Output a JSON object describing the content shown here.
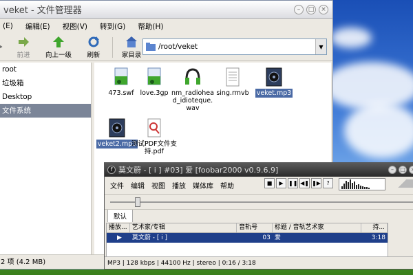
{
  "file_manager": {
    "title": "veket - 文件管理器",
    "menu": [
      "(E)",
      "编辑(E)",
      "视图(V)",
      "转到(G)",
      "帮助(H)"
    ],
    "toolbar": {
      "forward": "前进",
      "up": "向上一级",
      "refresh": "刷新",
      "home": "家目录"
    },
    "address": "/root/veket",
    "sidebar": [
      "root",
      "垃圾箱",
      "Desktop",
      "文件系统"
    ],
    "files": [
      {
        "name": "473.swf",
        "icon": "media-file-icon"
      },
      {
        "name": "love.3gp",
        "icon": "media-file-icon"
      },
      {
        "name": "nm_radiohead_idioteque.wav",
        "icon": "audio-file-icon"
      },
      {
        "name": "sing.rmvb",
        "icon": "text-file-icon"
      },
      {
        "name": "veket.mp3",
        "icon": "mp3-file-icon"
      },
      {
        "name": "veket2.mp3",
        "icon": "mp3-file-icon"
      },
      {
        "name": "测试PDF文件支持.pdf",
        "icon": "pdf-file-icon"
      }
    ],
    "status": "2 项 (4.2 MB)"
  },
  "foobar": {
    "title": "莫文蔚 - [ i ] #03] 爱  [foobar2000 v0.9.6.9]",
    "menu": [
      "文件",
      "编辑",
      "视图",
      "播放",
      "媒体库",
      "帮助"
    ],
    "tab": "默认",
    "columns": [
      "播放...",
      "艺术家/专辑",
      "音轨号",
      "标题 / 音轨艺术家",
      "持..."
    ],
    "row": {
      "playing": "▶",
      "artist": "莫文蔚 - [ i ]",
      "track": "03",
      "title": "爱",
      "length": "3:18"
    },
    "status": "MP3 | 128 kbps | 44100 Hz | stereo | 0:16 / 3:18",
    "seek_fraction": 0.08
  }
}
